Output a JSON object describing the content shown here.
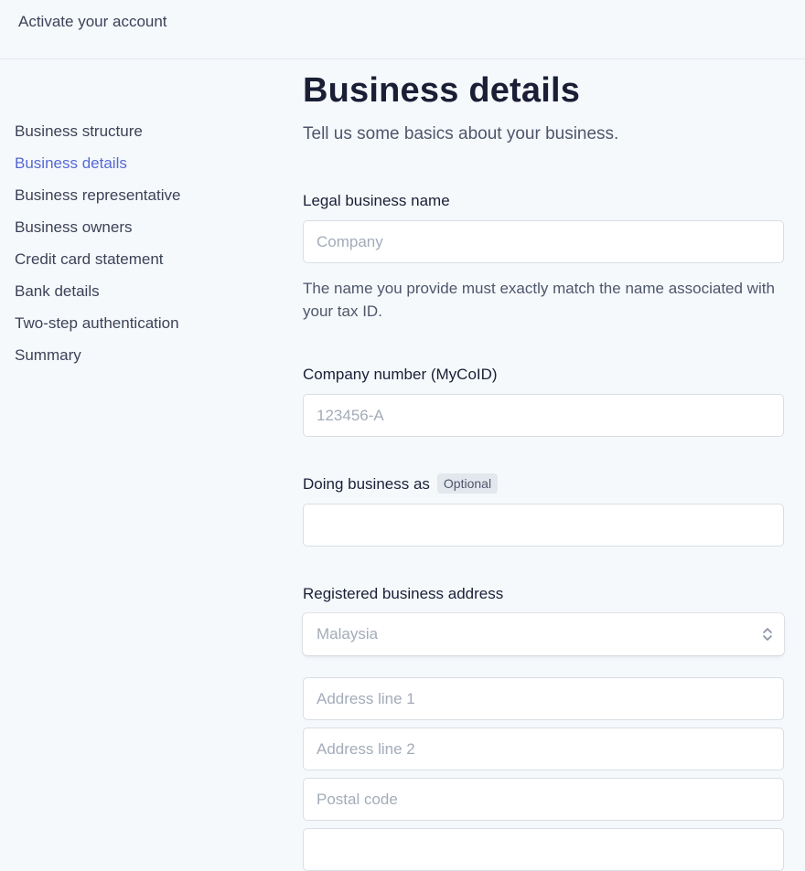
{
  "header": {
    "title": "Activate your account"
  },
  "sidebar": {
    "items": [
      {
        "label": "Business structure",
        "active": false
      },
      {
        "label": "Business details",
        "active": true
      },
      {
        "label": "Business representative",
        "active": false
      },
      {
        "label": "Business owners",
        "active": false
      },
      {
        "label": "Credit card statement",
        "active": false
      },
      {
        "label": "Bank details",
        "active": false
      },
      {
        "label": "Two-step authentication",
        "active": false
      },
      {
        "label": "Summary",
        "active": false
      }
    ]
  },
  "main": {
    "title": "Business details",
    "subtitle": "Tell us some basics about your business.",
    "fields": {
      "legal_name": {
        "label": "Legal business name",
        "placeholder": "Company",
        "value": "",
        "help": "The name you provide must exactly match the name associated with your tax ID."
      },
      "company_number": {
        "label": "Company number (MyCoID)",
        "placeholder": "123456-A",
        "value": ""
      },
      "dba": {
        "label": "Doing business as",
        "badge": "Optional",
        "placeholder": "",
        "value": ""
      },
      "address": {
        "label": "Registered business address",
        "country": "Malaysia",
        "line1_placeholder": "Address line 1",
        "line2_placeholder": "Address line 2",
        "postal_placeholder": "Postal code",
        "next_placeholder": ""
      }
    }
  },
  "colors": {
    "accent": "#5469d4",
    "text": "#3c4257",
    "heading": "#1a1f36",
    "placeholder": "#a3acb9",
    "background": "#f6f9fc"
  }
}
